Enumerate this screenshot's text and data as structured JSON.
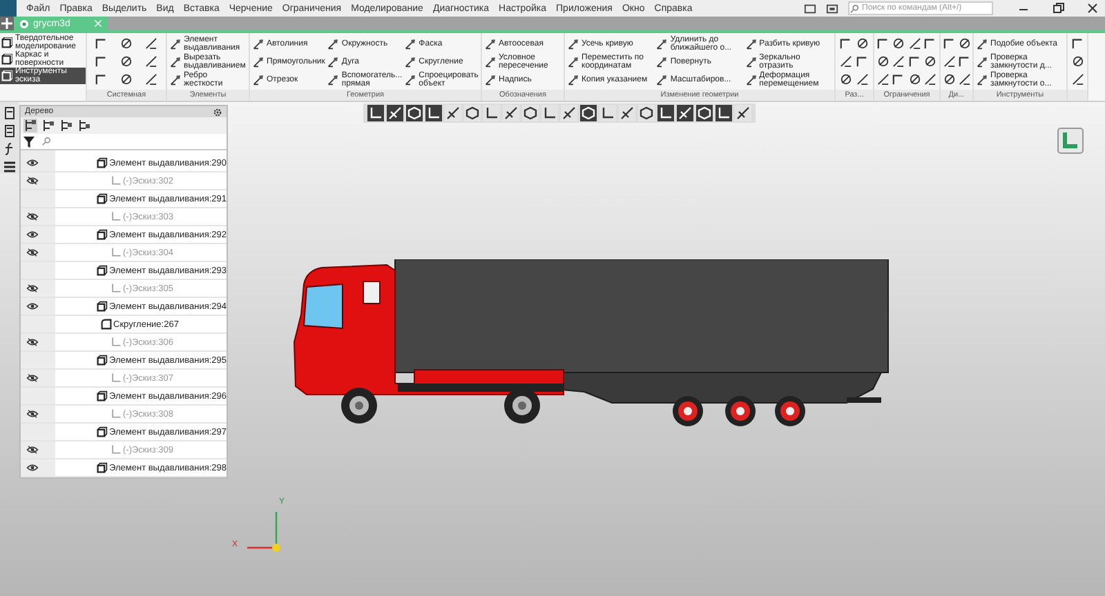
{
  "menu": [
    "Файл",
    "Правка",
    "Выделить",
    "Вид",
    "Вставка",
    "Черчение",
    "Ограничения",
    "Моделирование",
    "Диагностика",
    "Настройка",
    "Приложения",
    "Окно",
    "Справка"
  ],
  "search": {
    "placeholder": "Поиск по командам (Alt+/)"
  },
  "document_tab": {
    "label": "grycm3d",
    "selected": true
  },
  "modes": [
    {
      "label": "Твердотельное моделирование",
      "selected": false
    },
    {
      "label": "Каркас и поверхности",
      "selected": false
    },
    {
      "label": "Инструменты эскиза",
      "selected": true
    }
  ],
  "ribbon": [
    {
      "label": "Системная",
      "kind": "icons"
    },
    {
      "label": "Элементы",
      "kind": "buttons",
      "items": [
        "Элемент выдавливания",
        "Вырезать выдавливанием",
        "Ребро жесткости"
      ]
    },
    {
      "label": "Геометрия",
      "kind": "buttons",
      "items": [
        "Автолиния",
        "Прямоугольник",
        "Отрезок",
        "Окружность",
        "Дуга",
        "Вспомогатель... прямая",
        "Фаска",
        "Скругление",
        "Спроецировать объект"
      ]
    },
    {
      "label": "Обозначения",
      "kind": "buttons",
      "items": [
        "Автоосевая",
        "Условное пересечение",
        "Надпись"
      ]
    },
    {
      "label": "Изменение геометрии",
      "kind": "buttons",
      "items": [
        "Усечь кривую",
        "Переместить по координатам",
        "Копия указанием",
        "Удлинить до ближайшего о...",
        "Повернуть",
        "Масштабиров...",
        "Разбить кривую",
        "Зеркально отразить",
        "Деформация перемещением"
      ]
    },
    {
      "label": "Раз...",
      "kind": "icons"
    },
    {
      "label": "Ограничения",
      "kind": "icons"
    },
    {
      "label": "Ди...",
      "kind": "icons"
    },
    {
      "label": "Инструменты",
      "kind": "buttons",
      "items": [
        "Подобие объекта",
        "Проверка замкнутости д...",
        "Проверка замкнутости о..."
      ]
    },
    {
      "kind": "icons"
    }
  ],
  "view_toolbar": [
    {
      "selected": true
    },
    {
      "selected": true
    },
    {
      "selected": true
    },
    {
      "selected": true
    },
    {
      "selected": false
    },
    {
      "selected": false
    },
    {
      "selected": false
    },
    {
      "selected": false
    },
    {
      "selected": false
    },
    {
      "selected": false
    },
    {
      "selected": false
    },
    {
      "selected": true
    },
    {
      "selected": false
    },
    {
      "selected": false
    },
    {
      "selected": false
    },
    {
      "selected": true
    },
    {
      "selected": true
    },
    {
      "selected": true
    },
    {
      "selected": true
    },
    {
      "selected": false
    }
  ],
  "tree": {
    "title": "Дерево",
    "rows": [
      {
        "kind": "extrusion",
        "label": "Элемент выдавливания:290",
        "visible": true
      },
      {
        "kind": "sketch",
        "label": "(-)Эскиз:302",
        "visible": false
      },
      {
        "kind": "extrusion",
        "label": "Элемент выдавливания:291"
      },
      {
        "kind": "sketch",
        "label": "(-)Эскиз:303",
        "visible": false
      },
      {
        "kind": "extrusion",
        "label": "Элемент выдавливания:292",
        "visible": true
      },
      {
        "kind": "sketch",
        "label": "(-)Эскиз:304",
        "visible": false
      },
      {
        "kind": "extrusion",
        "label": "Элемент выдавливания:293"
      },
      {
        "kind": "sketch",
        "label": "(-)Эскиз:305",
        "visible": false
      },
      {
        "kind": "extrusion",
        "label": "Элемент выдавливания:294",
        "visible": true
      },
      {
        "kind": "fillet",
        "label": "Скругление:267"
      },
      {
        "kind": "sketch",
        "label": "(-)Эскиз:306",
        "visible": false
      },
      {
        "kind": "extrusion",
        "label": "Элемент выдавливания:295"
      },
      {
        "kind": "sketch",
        "label": "(-)Эскиз:307",
        "visible": false
      },
      {
        "kind": "extrusion",
        "label": "Элемент выдавливания:296"
      },
      {
        "kind": "sketch",
        "label": "(-)Эскиз:308",
        "visible": false
      },
      {
        "kind": "extrusion",
        "label": "Элемент выдавливания:297"
      },
      {
        "kind": "sketch",
        "label": "(-)Эскиз:309",
        "visible": false
      },
      {
        "kind": "extrusion",
        "label": "Элемент выдавливания:298",
        "visible": true
      }
    ]
  },
  "axes": {
    "x": "X",
    "y": "Y"
  }
}
